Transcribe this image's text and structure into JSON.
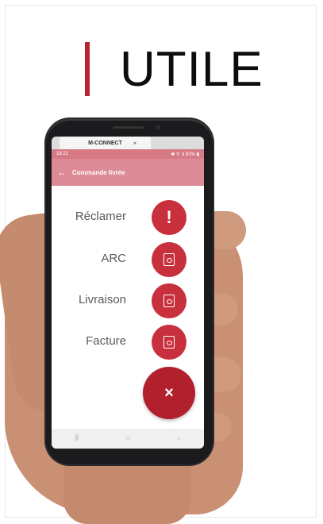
{
  "hero": {
    "title": "UTILE",
    "accent_color": "#b8232f"
  },
  "browser": {
    "tab_label": "M-CONNECT",
    "close_glyph": "×"
  },
  "status_bar": {
    "time": "18:21",
    "indicators": "✱ ⅌ .ıl 83% ▮"
  },
  "app_bar": {
    "title": "Commande livrée",
    "back_icon": "←"
  },
  "actions": [
    {
      "label": "Réclamer",
      "icon": "exclamation-icon"
    },
    {
      "label": "ARC",
      "icon": "pdf-icon"
    },
    {
      "label": "Livraison",
      "icon": "pdf-icon"
    },
    {
      "label": "Facture",
      "icon": "pdf-icon"
    }
  ],
  "main_fab": {
    "icon": "close-icon",
    "glyph": "×",
    "color": "#b21f2d"
  },
  "nav": {
    "recent": "⦀",
    "home": "○",
    "back": "‹"
  }
}
